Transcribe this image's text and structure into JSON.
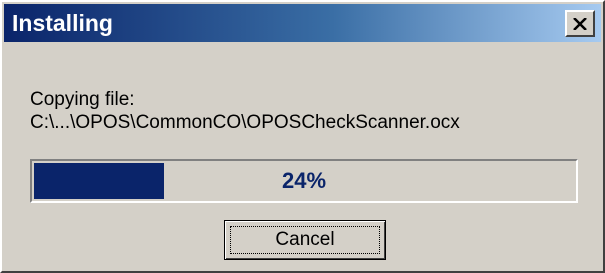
{
  "window": {
    "title": "Installing",
    "close_icon": "close-x-icon"
  },
  "status": {
    "line1": "Copying file:",
    "line2": "C:\\...\\OPOS\\CommonCO\\OPOSCheckScanner.ocx"
  },
  "progress": {
    "percent": 24,
    "label": "24%"
  },
  "buttons": {
    "cancel_label": "Cancel"
  },
  "colors": {
    "title_gradient_start": "#0a246a",
    "title_gradient_end": "#a6caf0",
    "face": "#d4d0c8",
    "progress_fill": "#0a246a"
  }
}
